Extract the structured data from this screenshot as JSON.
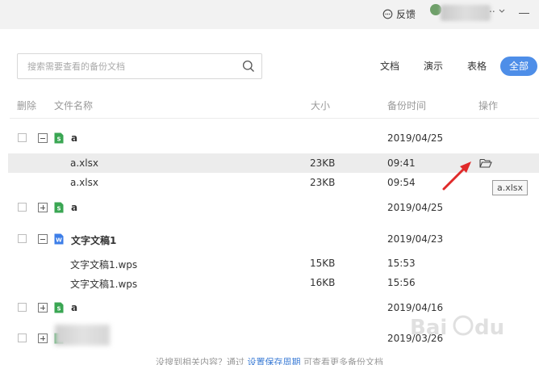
{
  "topbar": {
    "feedback_label": "反馈",
    "dots": "..",
    "icons": [
      "feedback-icon",
      "chevron-down-icon",
      "minimize-icon"
    ]
  },
  "search": {
    "placeholder": "搜索需要查看的备份文档",
    "icon": "search-icon"
  },
  "filters": [
    {
      "label": "文档",
      "active": false
    },
    {
      "label": "演示",
      "active": false
    },
    {
      "label": "表格",
      "active": false
    },
    {
      "label": "全部",
      "active": true
    }
  ],
  "table": {
    "headers": {
      "delete": "删除",
      "filename": "文件名称",
      "size": "大小",
      "backup_time": "备份时间",
      "action": "操作"
    },
    "groups": [
      {
        "name": "a",
        "type": "sheet",
        "expanded": true,
        "date": "2019/04/25"
      },
      {
        "name": "a",
        "type": "sheet",
        "expanded": false,
        "date": "2019/04/25"
      },
      {
        "name": "文字文稿1",
        "type": "doc",
        "expanded": true,
        "date": "2019/04/23"
      },
      {
        "name": "a",
        "type": "sheet",
        "expanded": false,
        "date": "2019/04/16"
      },
      {
        "name": "",
        "type": "sheet",
        "expanded": false,
        "date": "2019/03/26"
      }
    ],
    "files": [
      {
        "name": "a.xlsx",
        "size": "23KB",
        "time": "09:41"
      },
      {
        "name": "a.xlsx",
        "size": "23KB",
        "time": "09:54"
      },
      {
        "name": "文字文稿1.wps",
        "size": "15KB",
        "time": "15:53"
      },
      {
        "name": "文字文稿1.wps",
        "size": "16KB",
        "time": "15:56"
      }
    ]
  },
  "tooltip": "a.xlsx",
  "footer": {
    "prefix": "没搜到相关内容？通过 ",
    "link": "设置保存周期",
    "suffix": " 可查看更多备份文档"
  },
  "colors": {
    "accent": "#4e8ee8",
    "sheet_icon": "#3aa653",
    "doc_icon": "#3d7ee8",
    "arrow": "#e02a2a"
  }
}
